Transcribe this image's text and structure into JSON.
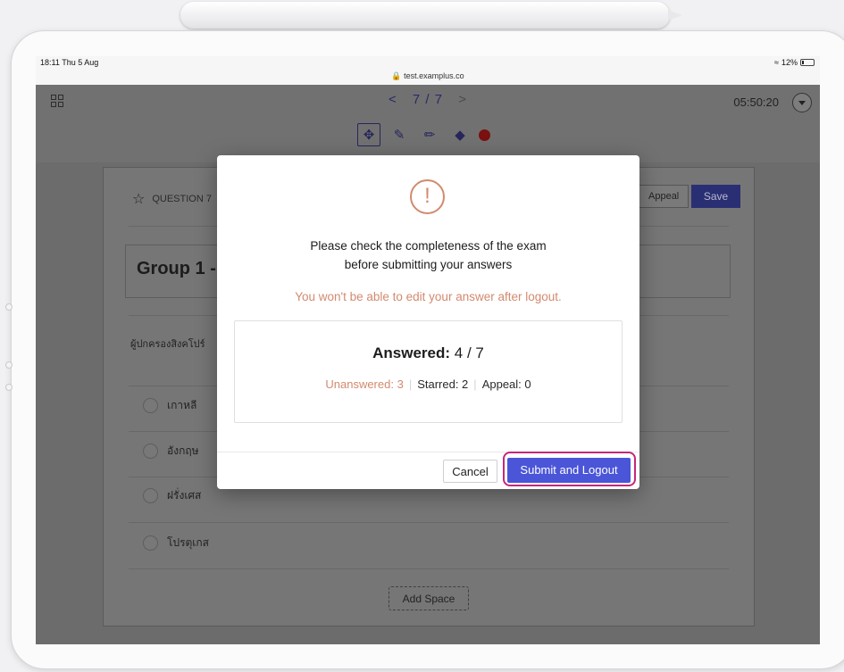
{
  "status_bar": {
    "time": "18:11  Thu 5 Aug",
    "url": "test.examplus.co",
    "battery": "12%"
  },
  "header": {
    "prev": "<",
    "page": "7 / 7",
    "next": ">",
    "timer": "05:50:20"
  },
  "tools": [
    "move-icon",
    "pen-icon",
    "highlighter-icon",
    "eraser-icon",
    "color-dot"
  ],
  "question": {
    "label": "QUESTION 7",
    "appeal_label": "Appeal",
    "save_label": "Save",
    "group_title": "Group 1 -",
    "text": "ผู้ปกครองสิงคโปร์",
    "options": [
      "เกาหลี",
      "อังกฤษ",
      "ฝรั่งเศส",
      "โปรตุเกส"
    ],
    "add_space": "Add Space"
  },
  "modal": {
    "title_line1": "Please check the completeness of the exam",
    "title_line2": "before submitting your answers",
    "warning": "You won't be able to edit your answer after logout.",
    "answered_label": "Answered:",
    "answered_value": "4 / 7",
    "unanswered": "Unanswered: 3",
    "starred": "Starred: 2",
    "appeal": "Appeal: 0",
    "cancel_label": "Cancel",
    "submit_label": "Submit and Logout",
    "accent_color": "#d28a6e",
    "primary_color": "#4a55d8",
    "highlight_color": "#c4287a"
  }
}
